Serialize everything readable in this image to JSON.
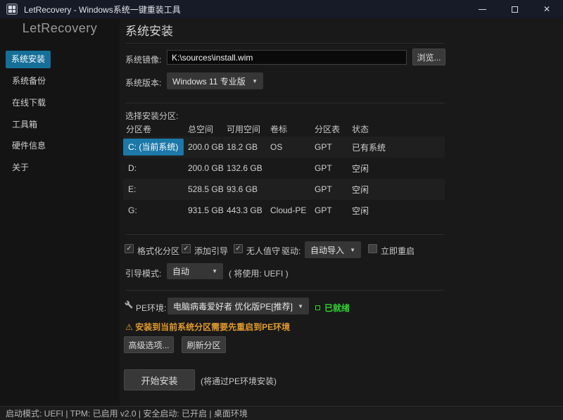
{
  "window": {
    "title": "LetRecovery - Windows系统一键重装工具",
    "close_glyph": "✕"
  },
  "sidebar": {
    "logo": "LetRecovery",
    "items": [
      {
        "label": "系统安装",
        "active": true
      },
      {
        "label": "系统备份",
        "active": false
      },
      {
        "label": "在线下载",
        "active": false
      },
      {
        "label": "工具箱",
        "active": false
      },
      {
        "label": "硬件信息",
        "active": false
      },
      {
        "label": "关于",
        "active": false
      }
    ]
  },
  "main": {
    "page_title": "系统安装",
    "image_row": {
      "label": "系统镜像:",
      "value": "K:\\sources\\install.wim",
      "browse_label": "浏览..."
    },
    "version_row": {
      "label": "系统版本:",
      "value": "Windows 11 专业版",
      "caret": "▼"
    },
    "partition": {
      "label": "选择安装分区:",
      "headers": [
        "分区卷",
        "总空间",
        "可用空间",
        "卷标",
        "分区表",
        "状态"
      ],
      "rows": [
        {
          "volume": "C: (当前系统)",
          "total": "200.0 GB",
          "free": "18.2 GB",
          "name": "OS",
          "table": "GPT",
          "status": "已有系统",
          "selected": true
        },
        {
          "volume": "D:",
          "total": "200.0 GB",
          "free": "132.6 GB",
          "name": "",
          "table": "GPT",
          "status": "空闲",
          "selected": false
        },
        {
          "volume": "E:",
          "total": "528.5 GB",
          "free": "93.6 GB",
          "name": "",
          "table": "GPT",
          "status": "空闲",
          "selected": false
        },
        {
          "volume": "G:",
          "total": "931.5 GB",
          "free": "443.3 GB",
          "name": "Cloud-PE",
          "table": "GPT",
          "status": "空闲",
          "selected": false
        }
      ]
    },
    "options": {
      "format": {
        "label": "格式化分区",
        "checked": true
      },
      "add_boot": {
        "label": "添加引导",
        "checked": true
      },
      "unattended": {
        "label": "无人值守",
        "checked": true
      },
      "driver_label": "驱动:",
      "driver_value": "自动导入",
      "reboot": {
        "label": "立即重启",
        "checked": false
      },
      "boot_mode_label": "引导模式:",
      "boot_mode_value": "自动",
      "boot_mode_note": "( 将使用: UEFI )",
      "check_glyph": "✓",
      "caret": "▼"
    },
    "pe": {
      "label": "PE环境:",
      "value": "电脑病毒爱好者 优化版PE[推荐]",
      "caret": "▼",
      "ready_status": "已就绪",
      "warning_glyph": "⚠",
      "warning": "安装到当前系统分区需要先重启到PE环境",
      "advanced_label": "高级选项...",
      "refresh_label": "刷新分区"
    },
    "install": {
      "button_label": "开始安装",
      "note": "(将通过PE环境安装)"
    }
  },
  "statusbar": {
    "text": "启动模式: UEFI | TPM: 已启用 v2.0 | 安全启动: 已开启 | 桌面环境"
  },
  "colors": {
    "accent_blue": "#1b78a8",
    "nav_active": "#156f99",
    "success_green": "#2fd32f",
    "warning_orange": "#e09a2e",
    "titlebar": "#171b28"
  }
}
